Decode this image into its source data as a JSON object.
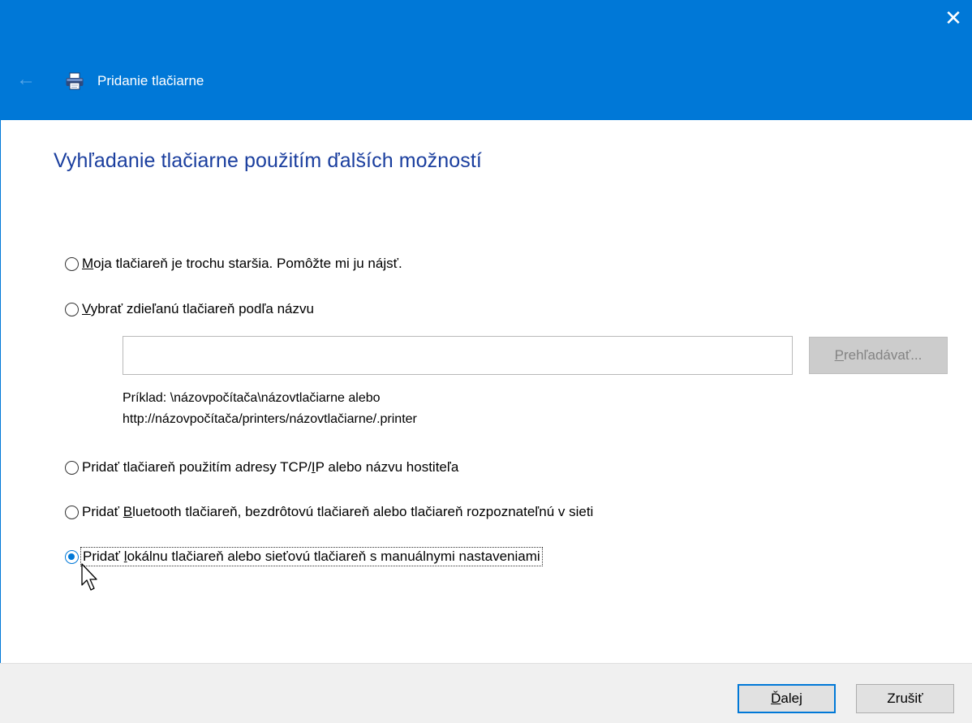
{
  "window": {
    "title": "Pridanie tlačiarne",
    "close_glyph": "✕",
    "back_glyph": "←",
    "accent_color": "#0078d7"
  },
  "heading": "Vyhľadanie tlačiarne použitím ďalších možností",
  "options": [
    {
      "pre": "",
      "key": "M",
      "post": "oja tlačiareň je trochu staršia. Pomôžte mi ju nájsť.",
      "checked": false
    },
    {
      "pre": "",
      "key": "V",
      "post": "ybrať zdieľanú tlačiareň podľa názvu",
      "checked": false
    },
    {
      "pre": "Pridať tlačiareň použitím adresy TCP/",
      "key": "I",
      "post": "P alebo názvu hostiteľa",
      "checked": false
    },
    {
      "pre": "Pridať ",
      "key": "B",
      "post": "luetooth tlačiareň, bezdrôtovú tlačiareň alebo tlačiareň rozpoznateľnú v sieti",
      "checked": false
    },
    {
      "pre": "Pridať ",
      "key": "l",
      "post": "okálnu tlačiareň alebo sieťovú tlačiareň s manuálnymi nastaveniami",
      "checked": true
    }
  ],
  "shared_printer": {
    "input_value": "",
    "browse_key": "P",
    "browse_rest": "rehľadávať...",
    "example_line1": "Príklad: \\názovpočítača\\názovtlačiarne alebo",
    "example_line2": "http://názovpočítača/printers/názovtlačiarne/.printer"
  },
  "footer": {
    "next_key": "Ď",
    "next_rest": "alej",
    "cancel_label": "Zrušiť"
  }
}
